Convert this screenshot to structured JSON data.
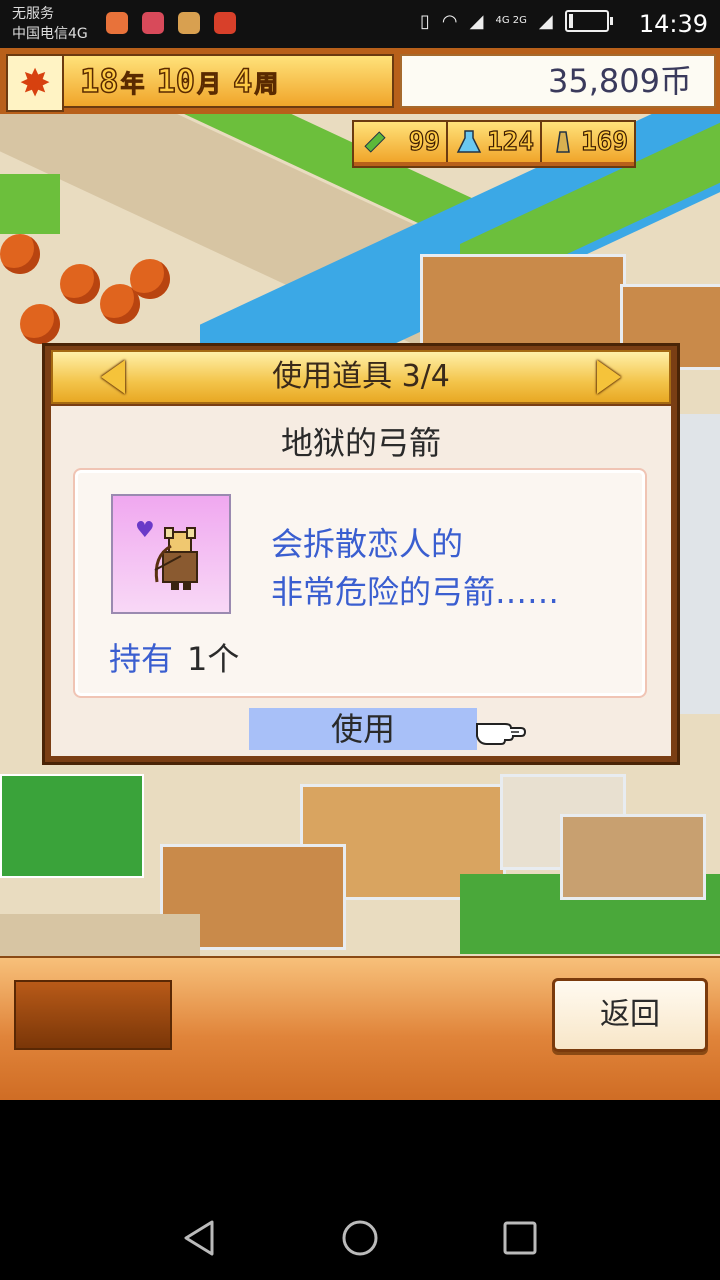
{
  "status_bar": {
    "carrier_line1": "无服务",
    "carrier_line2": "中国电信4G",
    "network_label": "4G 2G",
    "time": "14:39"
  },
  "top_bar": {
    "year": "18",
    "year_unit": "年",
    "month": "10",
    "month_unit": "月",
    "week": "4",
    "week_unit": "周",
    "money": "35,809币"
  },
  "resources": [
    {
      "icon": "pencil-icon",
      "value": "99"
    },
    {
      "icon": "flask-icon",
      "value": "124"
    },
    {
      "icon": "bell-icon",
      "value": "169"
    }
  ],
  "dialog": {
    "title": "使用道具 3/4",
    "item_name": "地狱的弓箭",
    "description_line1": "会拆散恋人的",
    "description_line2": "非常危险的弓箭……",
    "owned_label": "持有",
    "owned_count": "1个",
    "use_button": "使用"
  },
  "bottom": {
    "back_button": "返回"
  },
  "colors": {
    "gold": "#f3c44a",
    "panel_brown": "#b8601a",
    "text_blue": "#3a5ed0",
    "use_highlight": "#a8c0f8"
  }
}
